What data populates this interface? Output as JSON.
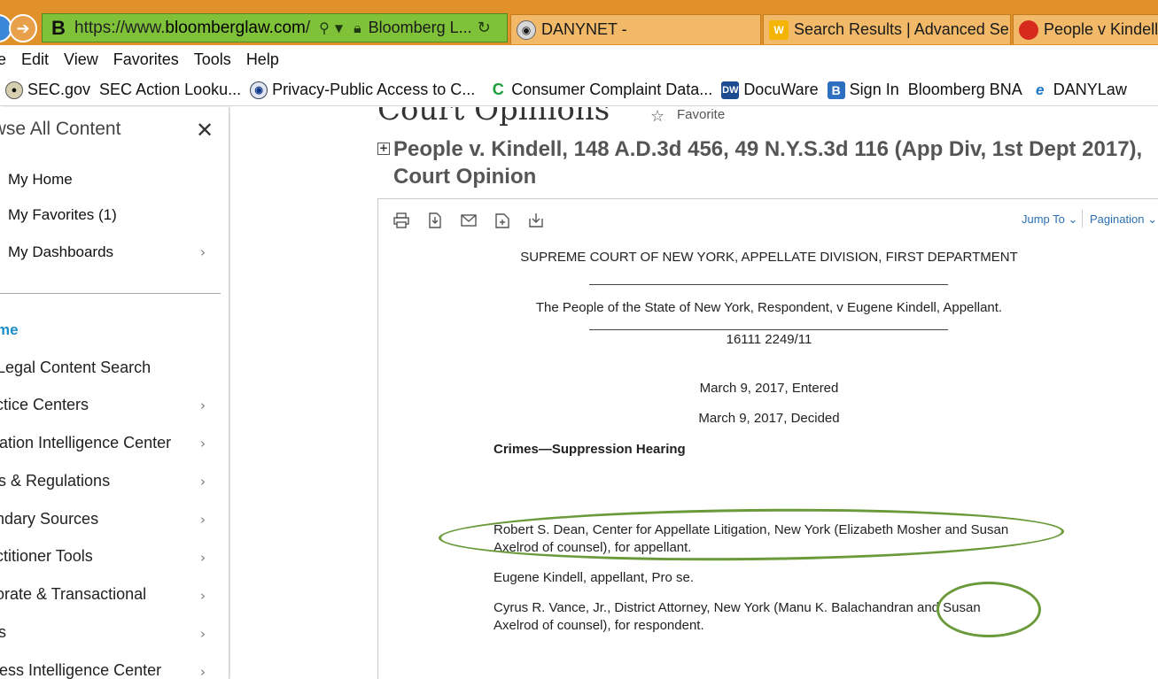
{
  "browser": {
    "address_url_prefix": "https://www.",
    "address_url_host": "bloomberglaw.com",
    "address_url_suffix": "/",
    "address_tab_label": "Bloomberg L...",
    "address_icon": "B",
    "tabs": [
      {
        "label": "DANYNET -",
        "icon": "seal-icon"
      },
      {
        "label": "Search Results | Advanced Se...",
        "icon": "w-icon"
      },
      {
        "label": "People v Kindell,",
        "icon": "red-logo-icon"
      }
    ]
  },
  "menu": [
    "e",
    "Edit",
    "View",
    "Favorites",
    "Tools",
    "Help"
  ],
  "favorites": [
    {
      "label": "SEC.gov",
      "icon": "seal-icon"
    },
    {
      "label": "SEC Action Looku...",
      "icon": ""
    },
    {
      "label": "Privacy-Public Access to C...",
      "icon": "seal-icon"
    },
    {
      "label": "Consumer Complaint Data...",
      "icon": "c-icon"
    },
    {
      "label": "DocuWare",
      "icon": "dw-icon"
    },
    {
      "label": "Sign In",
      "icon": "b-icon"
    },
    {
      "label": "Bloomberg BNA",
      "icon": ""
    },
    {
      "label": "DANYLaw",
      "icon": "ie-icon"
    }
  ],
  "sidebar": {
    "title": "owse All Content",
    "my_items": [
      "My Home",
      "My Favorites (1)",
      "My Dashboards"
    ],
    "home_link": "me",
    "nav_items": [
      "Legal Content Search",
      "actice Centers",
      "igation Intelligence Center",
      "ws & Regulations",
      "ondary Sources",
      "actitioner Tools",
      "porate & Transactional",
      "ws",
      "iness Intelligence Center"
    ]
  },
  "main": {
    "page_title": "Court Opinions",
    "favorite_label": "Favorite",
    "doc_heading": "People v. Kindell, 148 A.D.3d 456, 49 N.Y.S.3d 116 (App Div, 1st Dept 2017), Court Opinion",
    "toolbar": {
      "jump_to": "Jump To",
      "pagination": "Pagination"
    },
    "document": {
      "court": "SUPREME COURT OF NEW YORK, APPELLATE DIVISION, FIRST DEPARTMENT",
      "parties": "The People of the State of New York, Respondent, v Eugene Kindell, Appellant.",
      "docket": "16111 2249/11",
      "entered": "March 9, 2017, Entered",
      "decided": "March 9, 2017, Decided",
      "headnote": "Crimes—Suppression Hearing",
      "counsel_appellant": "Robert S. Dean, Center for Appellate Litigation, New York (Elizabeth Mosher and Susan Axelrod of counsel), for appellant.",
      "pro_se": "Eugene Kindell, appellant, Pro se.",
      "counsel_respondent": "Cyrus R. Vance, Jr., District Attorney, New York (Manu K. Balachandran and Susan Axelrod of counsel), for respondent."
    }
  },
  "colors": {
    "tabbar": "#e1912a",
    "address_bar": "#7fc23a",
    "link_blue": "#2b6fb3",
    "annotation_green": "#6a9a3a"
  }
}
